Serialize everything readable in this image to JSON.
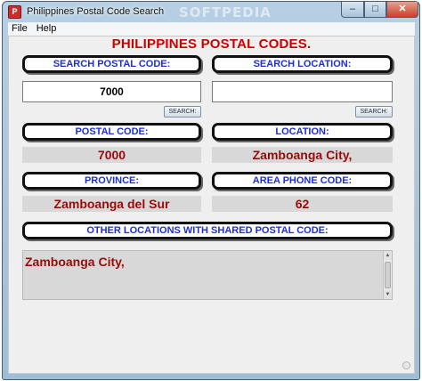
{
  "window": {
    "title": "Philippines Postal Code Search",
    "watermark": "SOFTPEDIA",
    "controls": {
      "minimize": "–",
      "maximize": "□",
      "close": "✕"
    }
  },
  "menu": {
    "items": [
      "File",
      "Help"
    ]
  },
  "main_title": "PHILIPPINES POSTAL CODES.",
  "search": {
    "postal_label": "SEARCH POSTAL CODE:",
    "postal_value": "7000",
    "location_label": "SEARCH LOCATION:",
    "location_value": "",
    "button_label": "SEARCH:"
  },
  "results": {
    "postal_code_label": "POSTAL CODE:",
    "postal_code_value": "7000",
    "location_label": "LOCATION:",
    "location_value": "Zamboanga City,",
    "province_label": "PROVINCE:",
    "province_value": "Zamboanga del Sur",
    "area_phone_label": "AREA PHONE CODE:",
    "area_phone_value": "62"
  },
  "shared": {
    "label": "OTHER LOCATIONS WITH SHARED POSTAL CODE:",
    "text": "Zamboanga City,"
  },
  "icons": {
    "app": "app-icon",
    "scroll_up": "▲",
    "scroll_down": "▼"
  }
}
